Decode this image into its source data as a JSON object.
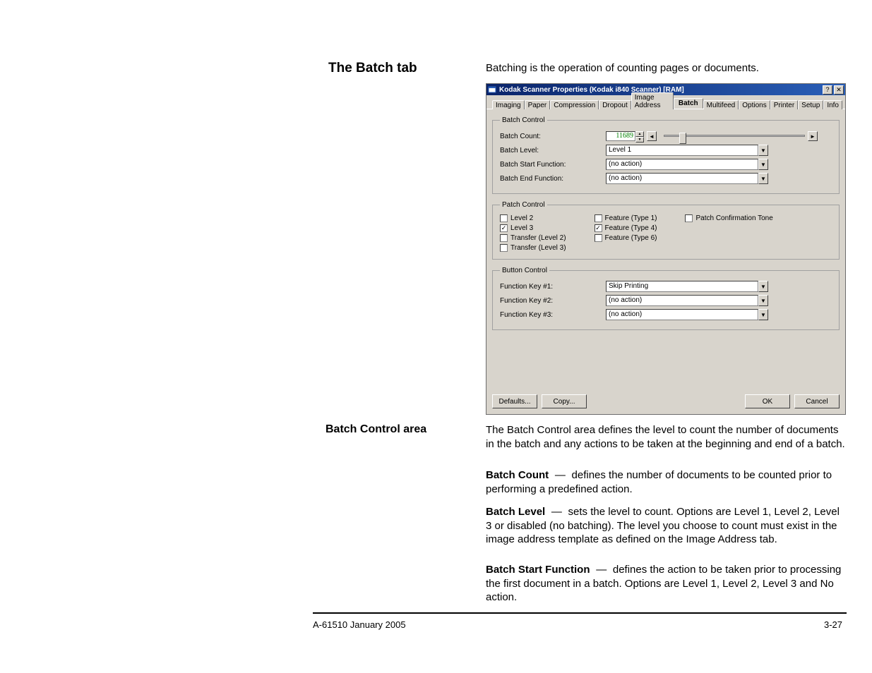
{
  "headings": {
    "batch_tab": "The Batch tab",
    "batch_control_area": "Batch Control area"
  },
  "intro": "Batching is the operation of counting pages or documents.",
  "dialog": {
    "title": "Kodak Scanner Properties (Kodak i840 Scanner) [RAM]",
    "help_btn": "?",
    "close_btn": "✕",
    "tabs": [
      "Imaging",
      "Paper",
      "Compression",
      "Dropout",
      "Image Address",
      "Batch",
      "Multifeed",
      "Options",
      "Printer",
      "Setup",
      "Info"
    ],
    "active_tab": "Batch",
    "group1": {
      "legend": "Batch Control",
      "batch_count_label": "Batch Count:",
      "batch_count_value": "11689",
      "batch_level_label": "Batch Level:",
      "batch_level_value": "Level 1",
      "batch_start_label": "Batch Start Function:",
      "batch_start_value": "(no action)",
      "batch_end_label": "Batch End Function:",
      "batch_end_value": "(no action)"
    },
    "group2": {
      "legend": "Patch Control",
      "col1": {
        "level2": {
          "label": "Level 2",
          "checked": false
        },
        "level3": {
          "label": "Level 3",
          "checked": true
        },
        "transfer_l2": {
          "label": "Transfer (Level 2)",
          "checked": false
        },
        "transfer_l3": {
          "label": "Transfer (Level 3)",
          "checked": false
        }
      },
      "col2": {
        "feature_t1": {
          "label": "Feature (Type 1)",
          "checked": false
        },
        "feature_t4": {
          "label": "Feature (Type 4)",
          "checked": true
        },
        "feature_t6": {
          "label": "Feature (Type 6)",
          "checked": false
        }
      },
      "col3": {
        "patch_tone": {
          "label": "Patch Confirmation Tone",
          "checked": false
        }
      }
    },
    "group3": {
      "legend": "Button Control",
      "fk1_label": "Function Key #1:",
      "fk1_value": "Skip Printing",
      "fk2_label": "Function Key #2:",
      "fk2_value": "(no action)",
      "fk3_label": "Function Key #3:",
      "fk3_value": "(no action)"
    },
    "buttons": {
      "defaults": "Defaults...",
      "copy": "Copy...",
      "ok": "OK",
      "cancel": "Cancel"
    }
  },
  "paragraphs": {
    "p1": "The Batch Control area defines the level to count the number of documents in the batch and any actions to be taken at the beginning and end of a batch.",
    "p2_a": "Batch Count",
    "p2_b": "defines the number of documents to be counted prior to performing a predefined action.",
    "p3_a": "Batch Level",
    "p3_b": "sets the level to count. Options are Level 1, Level 2, Level 3 or disabled (no batching). The level you choose to count must exist in the image address template as defined on the Image Address tab.",
    "p4_a": "Batch Start Function",
    "p4_b": "defines the action to be taken prior to processing the first document in a batch. Options are Level 1, Level 2, Level 3 and No action."
  },
  "dash": "—",
  "footer": {
    "left": "A-61510 January 2005",
    "right": "3-27"
  },
  "glyphs": {
    "check": "✓",
    "left": "◄",
    "right": "►",
    "down": "▼",
    "up": "▲"
  }
}
